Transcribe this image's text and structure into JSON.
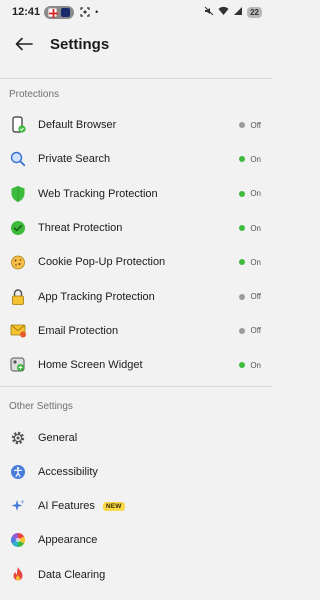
{
  "status_bar": {
    "time": "12:41",
    "battery": "22"
  },
  "header": {
    "title": "Settings"
  },
  "colors": {
    "on_dot": "#3dbb3d",
    "off_dot": "#9b9b9b",
    "new_badge": "#f9d84a"
  },
  "protections": {
    "title": "Protections",
    "items": [
      {
        "label": "Default Browser",
        "status": "Off",
        "icon": "phone-check-icon"
      },
      {
        "label": "Private Search",
        "status": "On",
        "icon": "magnifier-icon"
      },
      {
        "label": "Web Tracking Protection",
        "status": "On",
        "icon": "green-shield-icon"
      },
      {
        "label": "Threat Protection",
        "status": "On",
        "icon": "green-globe-check-icon"
      },
      {
        "label": "Cookie Pop-Up Protection",
        "status": "On",
        "icon": "cookie-icon"
      },
      {
        "label": "App Tracking Protection",
        "status": "Off",
        "icon": "padlock-icon"
      },
      {
        "label": "Email Protection",
        "status": "Off",
        "icon": "envelope-icon"
      },
      {
        "label": "Home Screen Widget",
        "status": "On",
        "icon": "widget-icon"
      }
    ]
  },
  "other_settings": {
    "title": "Other Settings",
    "items": [
      {
        "label": "General",
        "icon": "gear-icon"
      },
      {
        "label": "Accessibility",
        "icon": "accessibility-icon"
      },
      {
        "label": "AI Features",
        "icon": "sparkle-icon",
        "badge": "NEW"
      },
      {
        "label": "Appearance",
        "icon": "color-wheel-icon"
      },
      {
        "label": "Data Clearing",
        "icon": "fire-icon"
      }
    ]
  }
}
